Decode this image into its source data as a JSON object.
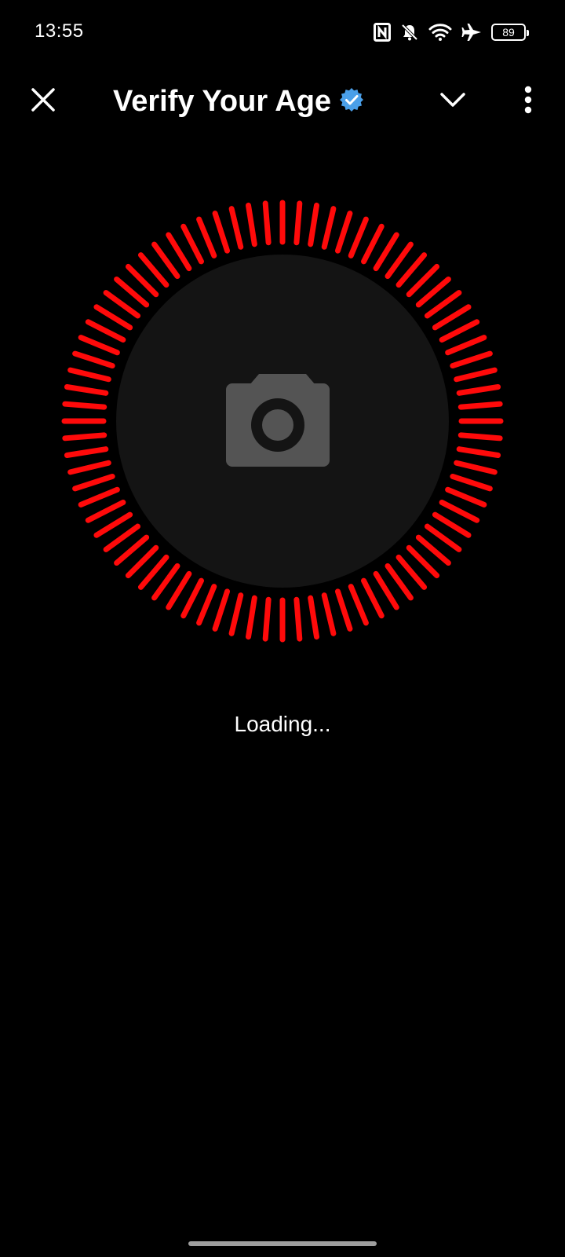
{
  "status_bar": {
    "time": "13:55",
    "battery": "89",
    "icons": [
      "nfc-icon",
      "bell-off-icon",
      "wifi-icon",
      "airplane-mode-icon",
      "battery-icon"
    ]
  },
  "app_bar": {
    "title": "Verify Your Age",
    "icons": [
      "close-icon",
      "verified-badge-icon",
      "chevron-down-icon",
      "more-vertical-icon"
    ]
  },
  "main": {
    "loading_text": "Loading...",
    "camera_icon": "camera-icon",
    "ring_color": "#ff0a0a",
    "badge_color": "#4a9fe8",
    "circle_color": "#141414",
    "camera_color": "#545454"
  }
}
